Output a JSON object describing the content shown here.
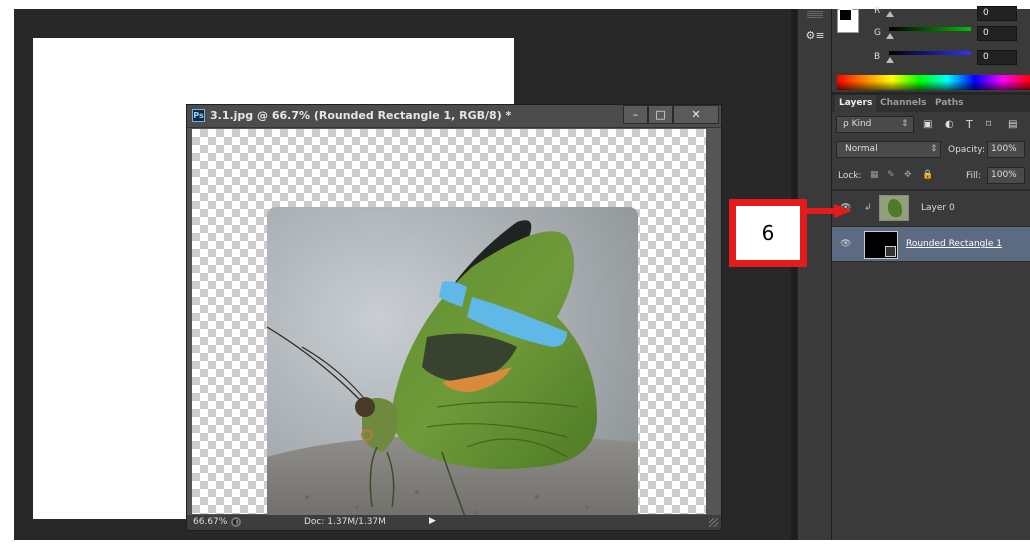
{
  "document_window": {
    "app_badge": "Ps",
    "title": "3.1.jpg @ 66.7% (Rounded Rectangle 1, RGB/8) *",
    "minimize": "–",
    "maximize": "□",
    "close": "✕",
    "zoom": "66.67%",
    "doc_info": "Doc: 1.37M/1.37M"
  },
  "color_panel": {
    "channels": [
      {
        "label": "R",
        "value": "0",
        "color": "#ff0000"
      },
      {
        "label": "G",
        "value": "0",
        "color": "#00c000"
      },
      {
        "label": "B",
        "value": "0",
        "color": "#3030ff"
      }
    ]
  },
  "layers_panel": {
    "tabs": [
      "Layers",
      "Channels",
      "Paths"
    ],
    "active_tab": "Layers",
    "filter_label": "ρ Kind",
    "blend_mode": "Normal",
    "opacity_label": "Opacity:",
    "opacity_value": "100%",
    "lock_label": "Lock:",
    "fill_label": "Fill:",
    "fill_value": "100%",
    "layers": [
      {
        "name": "Layer 0",
        "visible": true,
        "clipped": true,
        "selected": false
      },
      {
        "name": "Rounded Rectangle 1",
        "visible": true,
        "clipped": false,
        "selected": true
      }
    ]
  },
  "annotation": {
    "step_number": "6",
    "color": "#e31b1b"
  }
}
